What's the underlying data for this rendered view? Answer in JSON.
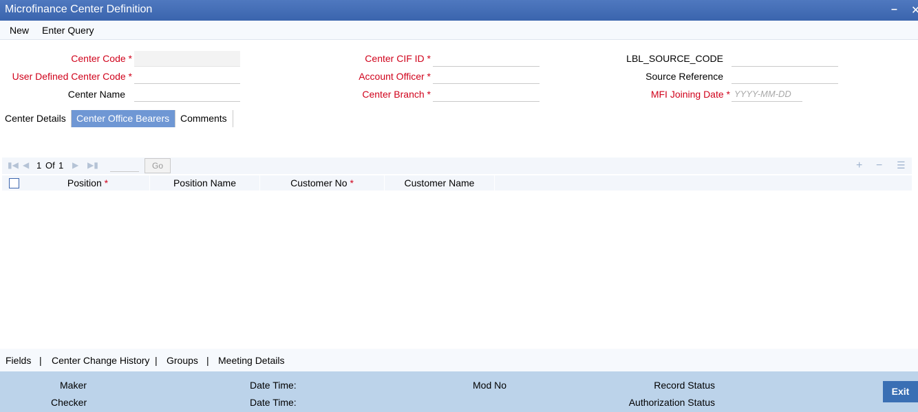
{
  "window": {
    "title": "Microfinance Center Definition",
    "minimize_label": "–",
    "close_label": "✕"
  },
  "menu": {
    "new_label": "New",
    "enter_query_label": "Enter Query"
  },
  "form": {
    "center_code": {
      "label": "Center Code",
      "required_mark": "*",
      "value": ""
    },
    "user_defined_center_code": {
      "label": "User Defined Center Code",
      "required_mark": "*",
      "value": ""
    },
    "center_name": {
      "label": "Center Name",
      "value": ""
    },
    "center_cif_id": {
      "label": "Center CIF ID",
      "required_mark": "*",
      "value": ""
    },
    "account_officer": {
      "label": "Account Officer",
      "required_mark": "*",
      "value": ""
    },
    "center_branch": {
      "label": "Center Branch",
      "required_mark": "*",
      "value": ""
    },
    "source_code": {
      "label": "LBL_SOURCE_CODE",
      "value": ""
    },
    "source_reference": {
      "label": "Source Reference",
      "value": ""
    },
    "mfi_joining_date": {
      "label": "MFI Joining Date",
      "required_mark": "*",
      "placeholder": "YYYY-MM-DD"
    }
  },
  "tabs": [
    {
      "label": "Center Details",
      "active": false
    },
    {
      "label": "Center Office Bearers",
      "active": true
    },
    {
      "label": "Comments",
      "active": false
    }
  ],
  "pager": {
    "current": "1",
    "of_label": "Of",
    "total": "1",
    "go_label": "Go",
    "page_input": ""
  },
  "grid": {
    "columns": [
      {
        "label": "Position",
        "required": true
      },
      {
        "label": "Position Name",
        "required": false
      },
      {
        "label": "Customer No",
        "required": true
      },
      {
        "label": "Customer Name",
        "required": false
      }
    ],
    "required_mark": "*",
    "rows": []
  },
  "subbar": {
    "fields_label": "Fields",
    "center_change_history_label": "Center Change History",
    "groups_label": "Groups",
    "meeting_details_label": "Meeting Details",
    "separator": "|"
  },
  "footer": {
    "maker_label": "Maker",
    "checker_label": "Checker",
    "date_time_label": "Date Time:",
    "mod_no_label": "Mod No",
    "record_status_label": "Record Status",
    "authorization_status_label": "Authorization Status",
    "exit_label": "Exit"
  },
  "colors": {
    "titlebar": "#3a64ad",
    "active_tab": "#6f97d4",
    "required": "#d0021b",
    "footer": "#bcd3ea",
    "exit_button": "#3a6fb4"
  }
}
